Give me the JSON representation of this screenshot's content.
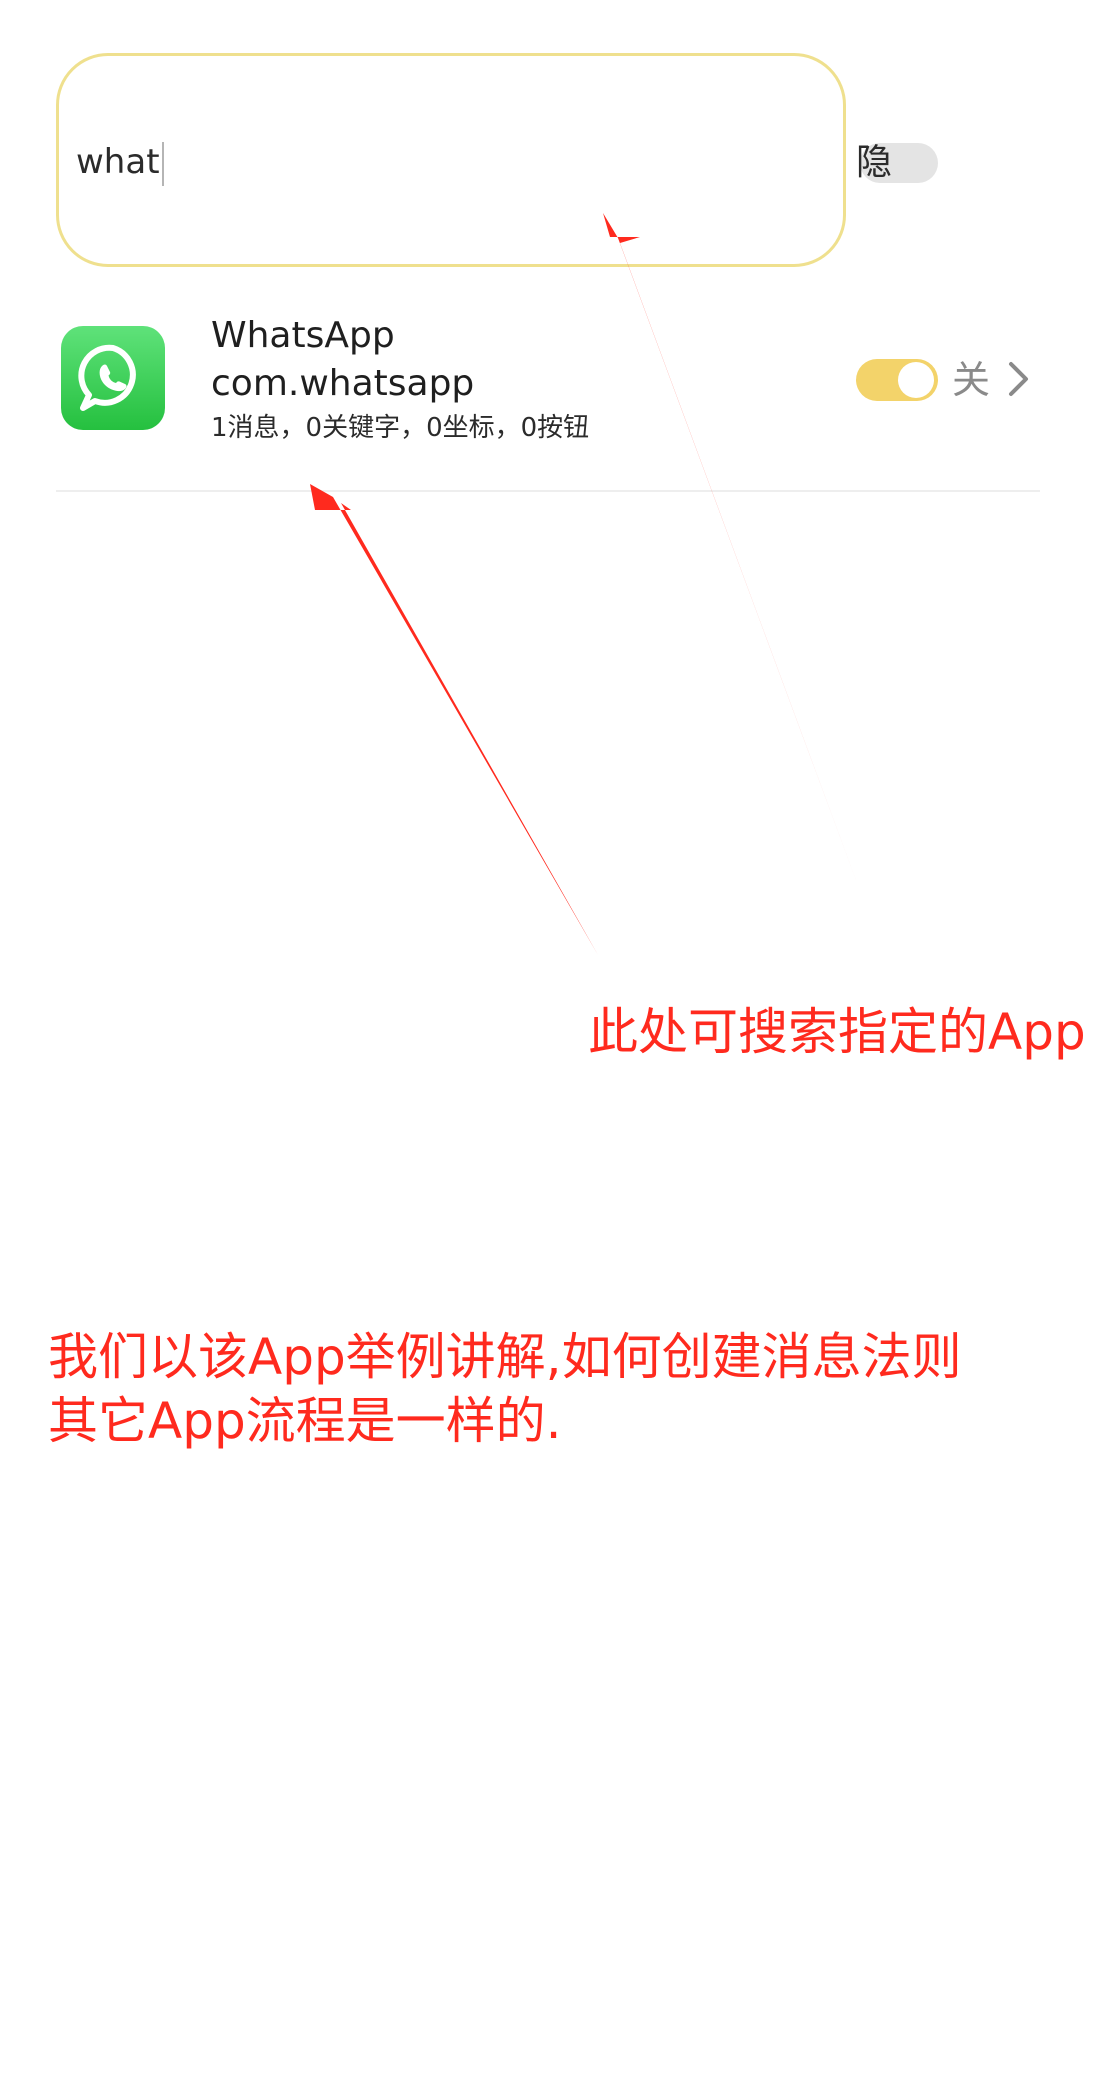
{
  "search": {
    "value": "what"
  },
  "hide_toggle": {
    "label": "隐",
    "on": false
  },
  "app": {
    "name": "WhatsApp",
    "package": "com.whatsapp",
    "stats": "1消息，0关键字，0坐标，0按钮",
    "toggle_on": true,
    "status": "关",
    "icon": "whatsapp-icon",
    "icon_color": "#25D366"
  },
  "annotations": {
    "search_note": "此处可搜索指定的App",
    "example_note_line1": "我们以该App举例讲解,如何创建消息法则",
    "example_note_line2": "其它App流程是一样的.",
    "color": "#FF2A1E"
  }
}
